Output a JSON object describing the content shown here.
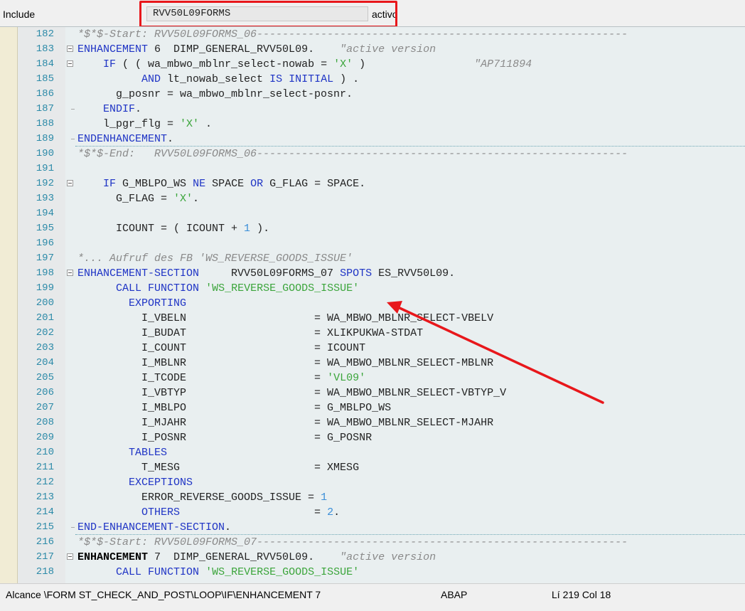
{
  "header": {
    "include_label": "Include",
    "program": "RVV50L09FORMS",
    "status": "activo"
  },
  "editor": {
    "lines": [
      {
        "num": "182",
        "fold": "",
        "sep": false,
        "tokens": [
          {
            "t": "*$*$-Start: RVV50L09FORMS_06----------------------------------------------------------",
            "c": "com"
          }
        ]
      },
      {
        "num": "183",
        "fold": "open",
        "sep": false,
        "tokens": [
          {
            "t": "ENHANCEMENT ",
            "c": "kw"
          },
          {
            "t": "6  DIMP_GENERAL_RVV50L09.    ",
            "c": "id"
          },
          {
            "t": "\"active version",
            "c": "com"
          }
        ]
      },
      {
        "num": "184",
        "fold": "open",
        "sep": false,
        "tokens": [
          {
            "t": "    ",
            "c": "id"
          },
          {
            "t": "IF",
            "c": "kw"
          },
          {
            "t": " ( ( wa_mbwo_mblnr_select-nowab = ",
            "c": "id"
          },
          {
            "t": "'X'",
            "c": "str"
          },
          {
            "t": " )                 ",
            "c": "id"
          },
          {
            "t": "\"AP711894",
            "c": "com"
          }
        ]
      },
      {
        "num": "185",
        "fold": "",
        "sep": false,
        "tokens": [
          {
            "t": "          ",
            "c": "id"
          },
          {
            "t": "AND",
            "c": "kw"
          },
          {
            "t": " lt_nowab_select ",
            "c": "id"
          },
          {
            "t": "IS INITIAL",
            "c": "kw"
          },
          {
            "t": " ) .",
            "c": "id"
          }
        ]
      },
      {
        "num": "186",
        "fold": "",
        "sep": false,
        "tokens": [
          {
            "t": "      g_posnr = wa_mbwo_mblnr_select-posnr.",
            "c": "id"
          }
        ]
      },
      {
        "num": "187",
        "fold": "end",
        "sep": false,
        "tokens": [
          {
            "t": "    ",
            "c": "id"
          },
          {
            "t": "ENDIF",
            "c": "kw"
          },
          {
            "t": ".",
            "c": "id"
          }
        ]
      },
      {
        "num": "188",
        "fold": "",
        "sep": false,
        "tokens": [
          {
            "t": "    l_pgr_flg = ",
            "c": "id"
          },
          {
            "t": "'X'",
            "c": "str"
          },
          {
            "t": " .",
            "c": "id"
          }
        ]
      },
      {
        "num": "189",
        "fold": "end",
        "sep": true,
        "tokens": [
          {
            "t": "ENDENHANCEMENT",
            "c": "kw"
          },
          {
            "t": ".",
            "c": "id"
          }
        ]
      },
      {
        "num": "190",
        "fold": "",
        "sep": false,
        "tokens": [
          {
            "t": "*$*$-End:   RVV50L09FORMS_06----------------------------------------------------------",
            "c": "com"
          }
        ]
      },
      {
        "num": "191",
        "fold": "",
        "sep": false,
        "tokens": []
      },
      {
        "num": "192",
        "fold": "open",
        "sep": false,
        "tokens": [
          {
            "t": "    ",
            "c": "id"
          },
          {
            "t": "IF",
            "c": "kw"
          },
          {
            "t": " G_MBLPO_WS ",
            "c": "id"
          },
          {
            "t": "NE",
            "c": "kw"
          },
          {
            "t": " SPACE ",
            "c": "id"
          },
          {
            "t": "OR",
            "c": "kw"
          },
          {
            "t": " G_FLAG = SPACE.",
            "c": "id"
          }
        ]
      },
      {
        "num": "193",
        "fold": "",
        "sep": false,
        "tokens": [
          {
            "t": "      G_FLAG = ",
            "c": "id"
          },
          {
            "t": "'X'",
            "c": "str"
          },
          {
            "t": ".",
            "c": "id"
          }
        ]
      },
      {
        "num": "194",
        "fold": "",
        "sep": false,
        "tokens": []
      },
      {
        "num": "195",
        "fold": "",
        "sep": false,
        "tokens": [
          {
            "t": "      ICOUNT = ( ICOUNT + ",
            "c": "id"
          },
          {
            "t": "1",
            "c": "num"
          },
          {
            "t": " ).",
            "c": "id"
          }
        ]
      },
      {
        "num": "196",
        "fold": "",
        "sep": false,
        "tokens": []
      },
      {
        "num": "197",
        "fold": "",
        "sep": false,
        "tokens": [
          {
            "t": "*... Aufruf des FB 'WS_REVERSE_GOODS_ISSUE'",
            "c": "com"
          }
        ]
      },
      {
        "num": "198",
        "fold": "open",
        "sep": false,
        "tokens": [
          {
            "t": "ENHANCEMENT-SECTION",
            "c": "kw"
          },
          {
            "t": "     RVV50L09FORMS_07 ",
            "c": "id"
          },
          {
            "t": "SPOTS",
            "c": "kw"
          },
          {
            "t": " ES_RVV50L09.",
            "c": "id"
          }
        ]
      },
      {
        "num": "199",
        "fold": "",
        "sep": false,
        "tokens": [
          {
            "t": "      ",
            "c": "id"
          },
          {
            "t": "CALL FUNCTION",
            "c": "kw"
          },
          {
            "t": " ",
            "c": "id"
          },
          {
            "t": "'WS_REVERSE_GOODS_ISSUE'",
            "c": "str"
          }
        ]
      },
      {
        "num": "200",
        "fold": "",
        "sep": false,
        "tokens": [
          {
            "t": "        ",
            "c": "id"
          },
          {
            "t": "EXPORTING",
            "c": "kw"
          }
        ]
      },
      {
        "num": "201",
        "fold": "",
        "sep": false,
        "tokens": [
          {
            "t": "          I_VBELN                    = WA_MBWO_MBLNR_SELECT-VBELV",
            "c": "id"
          }
        ]
      },
      {
        "num": "202",
        "fold": "",
        "sep": false,
        "tokens": [
          {
            "t": "          I_BUDAT                    = XLIKPUKWA-STDAT",
            "c": "id"
          }
        ]
      },
      {
        "num": "203",
        "fold": "",
        "sep": false,
        "tokens": [
          {
            "t": "          I_COUNT                    = ICOUNT",
            "c": "id"
          }
        ]
      },
      {
        "num": "204",
        "fold": "",
        "sep": false,
        "tokens": [
          {
            "t": "          I_MBLNR                    = WA_MBWO_MBLNR_SELECT-MBLNR",
            "c": "id"
          }
        ]
      },
      {
        "num": "205",
        "fold": "",
        "sep": false,
        "tokens": [
          {
            "t": "          I_TCODE                    = ",
            "c": "id"
          },
          {
            "t": "'VL09'",
            "c": "str"
          }
        ]
      },
      {
        "num": "206",
        "fold": "",
        "sep": false,
        "tokens": [
          {
            "t": "          I_VBTYP                    = WA_MBWO_MBLNR_SELECT-VBTYP_V",
            "c": "id"
          }
        ]
      },
      {
        "num": "207",
        "fold": "",
        "sep": false,
        "tokens": [
          {
            "t": "          I_MBLPO                    = G_MBLPO_WS",
            "c": "id"
          }
        ]
      },
      {
        "num": "208",
        "fold": "",
        "sep": false,
        "tokens": [
          {
            "t": "          I_MJAHR                    = WA_MBWO_MBLNR_SELECT-MJAHR",
            "c": "id"
          }
        ]
      },
      {
        "num": "209",
        "fold": "",
        "sep": false,
        "tokens": [
          {
            "t": "          I_POSNR                    = G_POSNR",
            "c": "id"
          }
        ]
      },
      {
        "num": "210",
        "fold": "",
        "sep": false,
        "tokens": [
          {
            "t": "        ",
            "c": "id"
          },
          {
            "t": "TABLES",
            "c": "kw"
          }
        ]
      },
      {
        "num": "211",
        "fold": "",
        "sep": false,
        "tokens": [
          {
            "t": "          T_MESG                     = XMESG",
            "c": "id"
          }
        ]
      },
      {
        "num": "212",
        "fold": "",
        "sep": false,
        "tokens": [
          {
            "t": "        ",
            "c": "id"
          },
          {
            "t": "EXCEPTIONS",
            "c": "kw"
          }
        ]
      },
      {
        "num": "213",
        "fold": "",
        "sep": false,
        "tokens": [
          {
            "t": "          ERROR_REVERSE_GOODS_ISSUE = ",
            "c": "id"
          },
          {
            "t": "1",
            "c": "num"
          }
        ]
      },
      {
        "num": "214",
        "fold": "",
        "sep": false,
        "tokens": [
          {
            "t": "          ",
            "c": "id"
          },
          {
            "t": "OTHERS",
            "c": "kw"
          },
          {
            "t": "                     = ",
            "c": "id"
          },
          {
            "t": "2",
            "c": "num"
          },
          {
            "t": ".",
            "c": "id"
          }
        ]
      },
      {
        "num": "215",
        "fold": "end",
        "sep": true,
        "tokens": [
          {
            "t": "END-ENHANCEMENT-SECTION",
            "c": "kw"
          },
          {
            "t": ".",
            "c": "id"
          }
        ]
      },
      {
        "num": "216",
        "fold": "",
        "sep": false,
        "tokens": [
          {
            "t": "*$*$-Start: RVV50L09FORMS_07----------------------------------------------------------",
            "c": "com"
          }
        ]
      },
      {
        "num": "217",
        "fold": "open",
        "sep": false,
        "tokens": [
          {
            "t": "ENHANCEMENT",
            "c": "kwb"
          },
          {
            "t": " 7  DIMP_GENERAL_RVV50L09.    ",
            "c": "id"
          },
          {
            "t": "\"active version",
            "c": "com"
          }
        ]
      },
      {
        "num": "218",
        "fold": "",
        "sep": false,
        "tokens": [
          {
            "t": "      ",
            "c": "id"
          },
          {
            "t": "CALL FUNCTION",
            "c": "kw"
          },
          {
            "t": " ",
            "c": "id"
          },
          {
            "t": "'WS_REVERSE_GOODS_ISSUE'",
            "c": "str"
          }
        ]
      }
    ]
  },
  "statusbar": {
    "scope": "Alcance \\FORM ST_CHECK_AND_POST\\LOOP\\IF\\ENHANCEMENT 7",
    "language": "ABAP",
    "position": "Lí 219 Col  18"
  },
  "annotations": {
    "highlight_color": "#e8171b"
  }
}
